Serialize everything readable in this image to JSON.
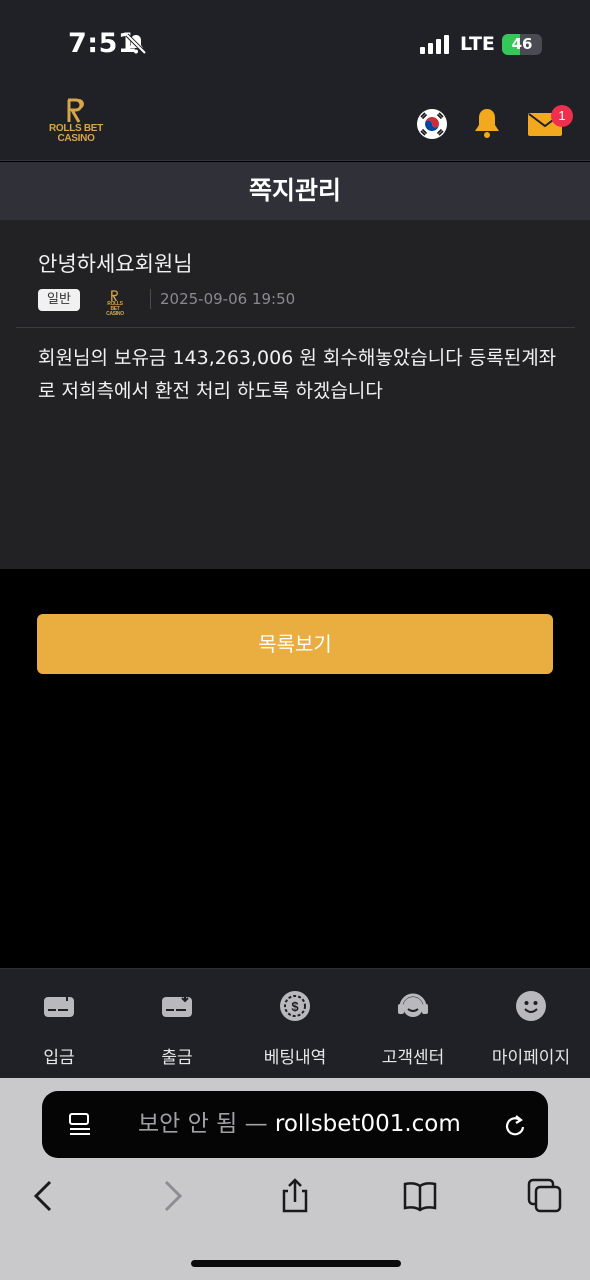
{
  "status_bar": {
    "time": "7:51",
    "network": "LTE",
    "battery": "46",
    "battery_level": 0.46
  },
  "header": {
    "logo_line1": "ROLLS BET",
    "logo_line2": "CASINO",
    "notification_count": "1"
  },
  "page": {
    "title": "쪽지관리"
  },
  "message": {
    "subject": "안녕하세요회원님",
    "category": "일반",
    "sender_logo_line1": "ROLLS BET",
    "sender_logo_line2": "CASINO",
    "date": "2025-09-06 19:50",
    "body": "회원님의 보유금 143,263,006 원 회수해놓았습니다 등록된계좌로 저희측에서 환전 처리 하도록 하겠습니다"
  },
  "list_button_label": "목록보기",
  "bottom_nav": {
    "items": [
      {
        "label": "입금",
        "icon": "deposit-card-icon"
      },
      {
        "label": "출금",
        "icon": "withdraw-card-icon"
      },
      {
        "label": "베팅내역",
        "icon": "dollar-chip-icon"
      },
      {
        "label": "고객센터",
        "icon": "headset-icon"
      },
      {
        "label": "마이페이지",
        "icon": "smiley-icon"
      }
    ]
  },
  "browser": {
    "security_text": "보안 안 됨",
    "separator": "—",
    "domain": "rollsbet001.com"
  },
  "colors": {
    "accent": "#eaad40",
    "badge": "#ee2f4d",
    "header_bg": "#202027",
    "panel_bg": "#222225"
  }
}
